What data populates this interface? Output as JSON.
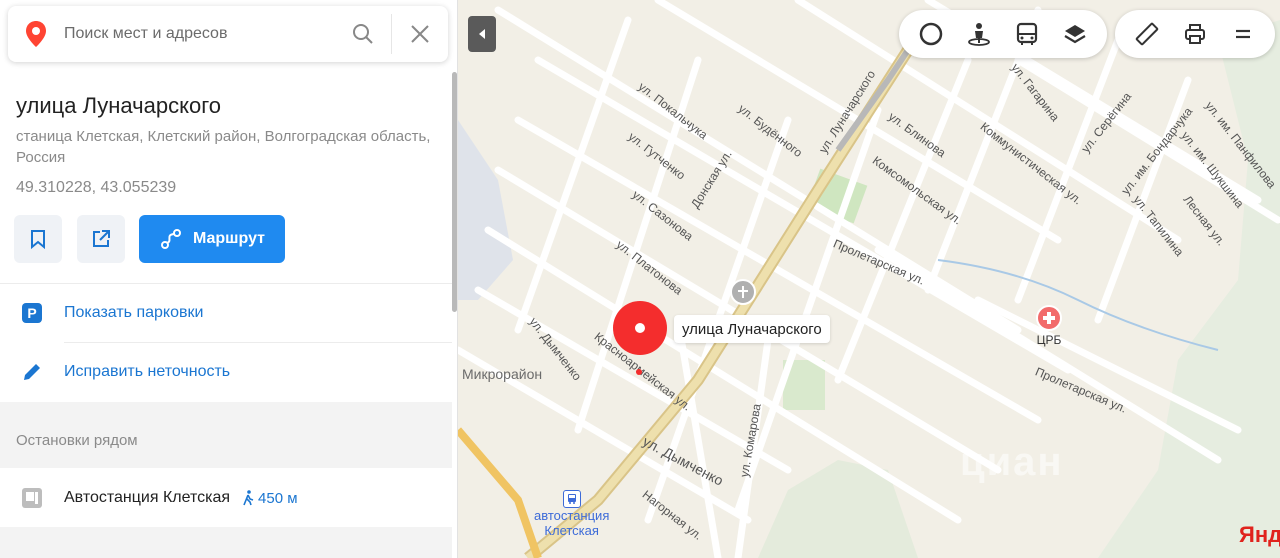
{
  "search": {
    "placeholder": "Поиск мест и адресов"
  },
  "place": {
    "title": "улица Луначарского",
    "address": "станица Клетская, Клетский район, Волгоградская область, Россия",
    "coordinates": "49.310228, 43.055239"
  },
  "actions": {
    "route_label": "Маршрут"
  },
  "links": [
    {
      "label": "Показать парковки"
    },
    {
      "label": "Исправить неточность"
    }
  ],
  "stops": {
    "title": "Остановки рядом",
    "items": [
      {
        "name": "Автостанция Клетская",
        "distance": "450 м"
      }
    ]
  },
  "map": {
    "marker_label": "улица Луначарского",
    "district": "Микрорайон",
    "poi": {
      "hospital": "ЦРБ",
      "bus_station": "автостанция\nКлетская"
    },
    "logo": "Янд",
    "watermark": "циан",
    "street_labels": [
      "ул. Покальчука",
      "ул. Будённого",
      "ул. Луначарского",
      "ул. Блинова",
      "ул. Гутченко",
      "Донская ул.",
      "Комсомольская ул.",
      "ул. Сазонова",
      "ул. Платонова",
      "Пролетарская ул.",
      "Пролетарская ул.",
      "ул. Дымченко",
      "Красноармейская ул.",
      "ул. Комарова",
      "ул. Дымченко",
      "Нагорная ул.",
      "Коммунистическая ул.",
      "ул. Гагарина",
      "ул. Серёгина",
      "ул. им. Бондарчука",
      "ул. им. Шукшина",
      "ул. им. Панфилова",
      "Лесная ул.",
      "ул. Тапилина"
    ]
  },
  "colors": {
    "accent": "#1f8af0",
    "marker": "#f42d2d",
    "link": "#1b76d1"
  }
}
